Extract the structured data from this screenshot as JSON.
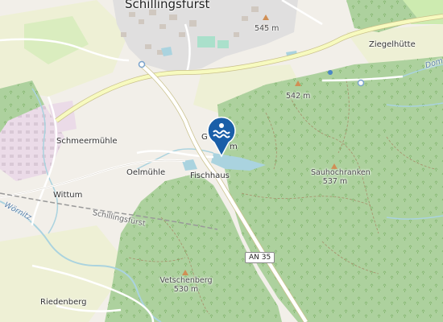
{
  "map": {
    "places": {
      "town": "Schillingsfürst",
      "ziegelhuette": "Ziegelhütte",
      "schmeermuehle": "Schmeermühle",
      "oelmuehle": "Oelmühle",
      "fischhaus": "Fischhaus",
      "wittum": "Wittum",
      "riedenberg": "Riedenberg"
    },
    "peaks": {
      "p545": "545 m",
      "p542": "542 m",
      "sauhochranken_name": "Sauhochranken",
      "sauhochranken_elev": "537 m",
      "vetschenberg_name": "Vetschenberg",
      "vetschenberg_elev": "530 m"
    },
    "water": {
      "woernitz": "Wörnitz",
      "dombach": "Dom"
    },
    "poi_partial": {
      "top": "G        rg",
      "bottom": "m"
    },
    "railway_label": "Schillingsfürst",
    "road_ref": "AN 35",
    "marker_icon": "swimming-water-icon",
    "colors": {
      "forest": "#add19e",
      "residential": "#e0dfdf",
      "industrial": "#ebdbe8",
      "farmland": "#eef0d5",
      "meadow": "#cdebb0",
      "water": "#aad3df",
      "main_road": "#f7fabf",
      "marker": "#1a5fa8"
    }
  }
}
